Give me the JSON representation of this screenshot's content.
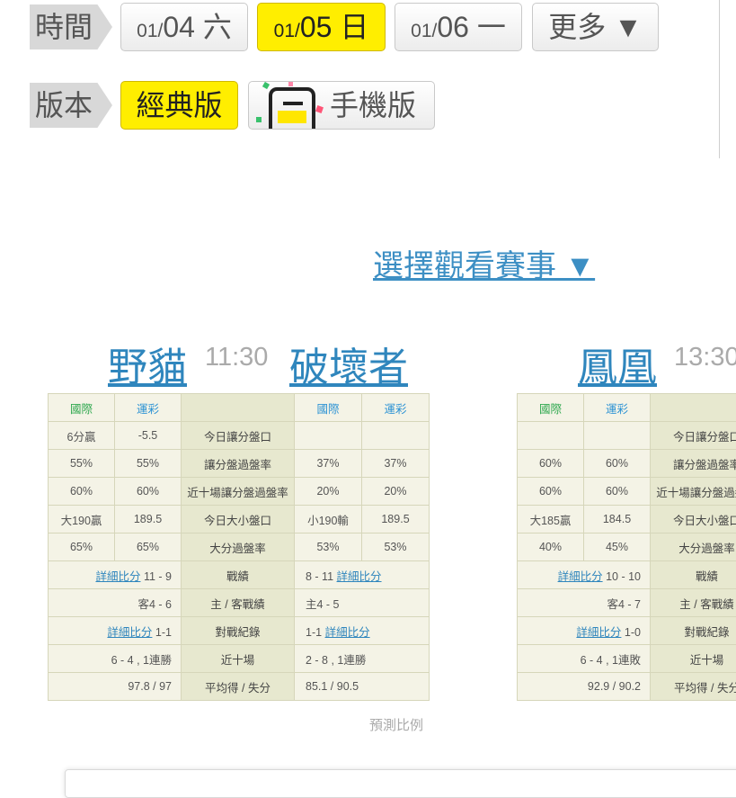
{
  "time_row": {
    "label": "時間",
    "dates": [
      {
        "small": "01/",
        "big": "04 六",
        "selected": false
      },
      {
        "small": "01/",
        "big": "05 日",
        "selected": true
      },
      {
        "small": "01/",
        "big": "06 一",
        "selected": false
      }
    ],
    "more": "更多 ▼"
  },
  "version_row": {
    "label": "版本",
    "classic": "經典版",
    "mobile": "手機版"
  },
  "choose_game": "選擇觀看賽事 ▼",
  "matches": [
    {
      "away": "野貓",
      "time": "11:30",
      "home": "破壞者",
      "hdr": {
        "intl": "國際",
        "lottery": "運彩"
      },
      "rows": {
        "spread_line": {
          "label": "今日讓分盤口",
          "a_intl": "6分贏",
          "a_lot": "-5.5",
          "h_intl": "",
          "h_lot": ""
        },
        "spread_rate": {
          "label": "讓分盤過盤率",
          "a_intl": "55%",
          "a_lot": "55%",
          "h_intl": "37%",
          "h_lot": "37%"
        },
        "last10_spread": {
          "label": "近十場讓分盤過盤率",
          "a_intl": "60%",
          "a_lot": "60%",
          "h_intl": "20%",
          "h_lot": "20%"
        },
        "total_line": {
          "label": "今日大小盤口",
          "a_intl": "大190贏",
          "a_lot": "189.5",
          "h_intl": "小190輸",
          "h_lot": "189.5"
        },
        "over_rate": {
          "label": "大分過盤率",
          "a_intl": "65%",
          "a_lot": "65%",
          "h_intl": "53%",
          "h_lot": "53%"
        },
        "record": {
          "label": "戰績",
          "a": "11 - 9",
          "h": "8 - 11",
          "link": "詳細比分"
        },
        "homeaway": {
          "label": "主 / 客戰績",
          "a": "客4 - 6",
          "h": "主4 - 5"
        },
        "h2h": {
          "label": "對戰紀錄",
          "a": "1-1",
          "h": "1-1",
          "link": "詳細比分"
        },
        "last10": {
          "label": "近十場",
          "a": "6 - 4 , 1連勝",
          "h": "2 - 8 , 1連勝"
        },
        "avg": {
          "label": "平均得 / 失分",
          "a": "97.8 / 97",
          "h": "85.1 / 90.5"
        }
      }
    },
    {
      "away": "鳳凰",
      "time": "13:30",
      "hdr": {
        "intl": "國際",
        "lottery": "運彩"
      },
      "rows": {
        "spread_line": {
          "label": "今日讓分盤口",
          "a_intl": "",
          "a_lot": ""
        },
        "spread_rate": {
          "label": "讓分盤過盤率",
          "a_intl": "60%",
          "a_lot": "60%"
        },
        "last10_spread": {
          "label": "近十場讓分盤過盤率",
          "a_intl": "60%",
          "a_lot": "60%"
        },
        "total_line": {
          "label": "今日大小盤口",
          "a_intl": "大185贏",
          "a_lot": "184.5"
        },
        "over_rate": {
          "label": "大分過盤率",
          "a_intl": "40%",
          "a_lot": "45%"
        },
        "record": {
          "label": "戰績",
          "a": "10 - 10",
          "link": "詳細比分"
        },
        "homeaway": {
          "label": "主 / 客戰績",
          "a": "客4 - 7"
        },
        "h2h": {
          "label": "對戰紀錄",
          "a": "1-0",
          "link": "詳細比分"
        },
        "last10": {
          "label": "近十場",
          "a": "6 - 4 , 1連敗"
        },
        "avg": {
          "label": "平均得 / 失分",
          "a": "92.9 / 90.2"
        }
      }
    }
  ],
  "footer_note": "預測比例",
  "colors": {
    "selected_yellow": "#ffee00",
    "link_blue": "#2f86bd",
    "header_green": "#2fa84f"
  }
}
